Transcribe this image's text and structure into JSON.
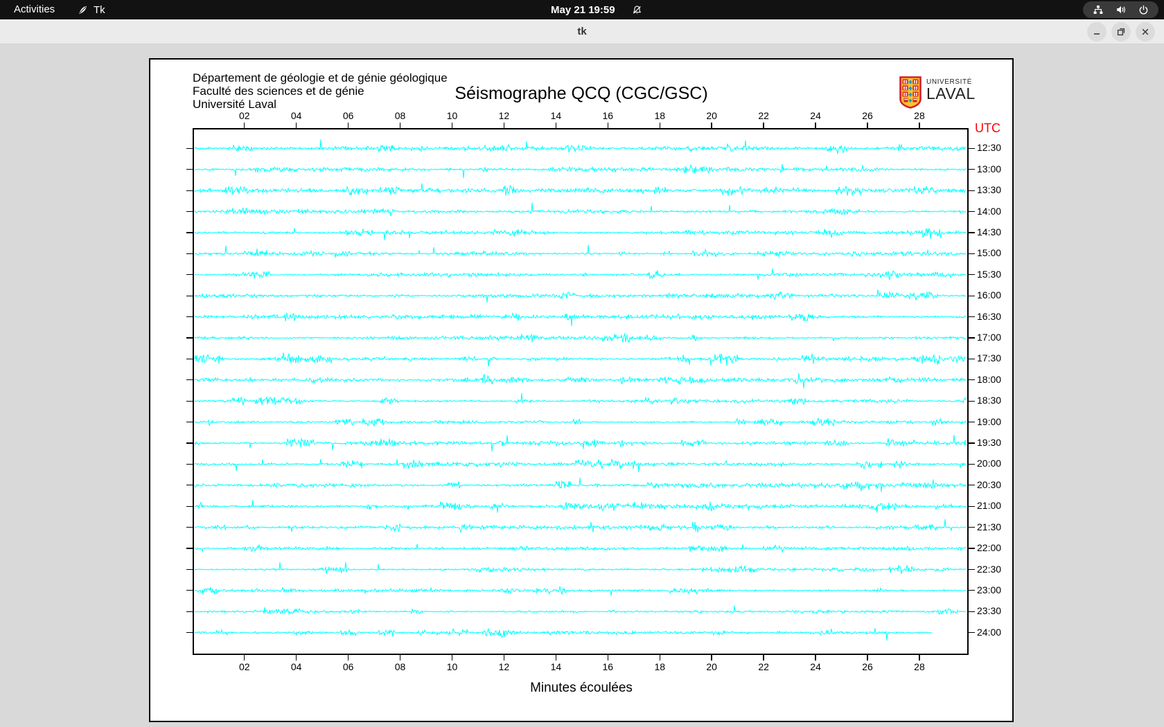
{
  "topbar": {
    "activities_label": "Activities",
    "app_name": "Tk",
    "clock": "May 21 19:59",
    "icons": {
      "app": "tk-feather-icon",
      "notifications": "bell-muted-icon",
      "network": "wired-network-icon",
      "volume": "speaker-icon",
      "power": "power-icon"
    }
  },
  "window": {
    "title": "tk",
    "controls": [
      "minimize",
      "restore",
      "close"
    ]
  },
  "canvas": {
    "header_lines": [
      "Département de géologie et de génie géologique",
      "Faculté des sciences et de génie",
      "Université Laval"
    ],
    "title": "Séismographe QCQ (CGC/GSC)",
    "logo": {
      "top": "UNIVERSITÉ",
      "bottom": "LAVAL"
    }
  },
  "chart_data": {
    "type": "line",
    "subtype": "helicorder-seismogram",
    "station": "QCQ (CGC/GSC)",
    "title": "Séismographe QCQ (CGC/GSC)",
    "xlabel": "Minutes écoulées",
    "x_range_minutes": [
      0,
      30
    ],
    "x_ticks": [
      "02",
      "04",
      "06",
      "08",
      "10",
      "12",
      "14",
      "16",
      "18",
      "20",
      "22",
      "24",
      "26",
      "28"
    ],
    "right_axis_label": "UTC",
    "right_axis_color": "#ff0000",
    "trace_color": "#00ffff",
    "axis_color": "#000000",
    "noise_seed": 20210521,
    "rows": [
      {
        "label": "12:30",
        "activity": 1.0
      },
      {
        "label": "13:00",
        "activity": 1.0
      },
      {
        "label": "13:30",
        "activity": 1.1
      },
      {
        "label": "14:00",
        "activity": 1.15
      },
      {
        "label": "14:30",
        "activity": 1.1
      },
      {
        "label": "15:00",
        "activity": 1.0
      },
      {
        "label": "15:30",
        "activity": 0.95
      },
      {
        "label": "16:00",
        "activity": 1.05
      },
      {
        "label": "16:30",
        "activity": 1.1
      },
      {
        "label": "17:00",
        "activity": 1.05
      },
      {
        "label": "17:30",
        "activity": 1.35
      },
      {
        "label": "18:00",
        "activity": 1.25
      },
      {
        "label": "18:30",
        "activity": 1.0
      },
      {
        "label": "19:00",
        "activity": 0.95
      },
      {
        "label": "19:30",
        "activity": 1.05
      },
      {
        "label": "20:00",
        "activity": 1.2
      },
      {
        "label": "20:30",
        "activity": 1.25
      },
      {
        "label": "21:00",
        "activity": 1.2
      },
      {
        "label": "21:30",
        "activity": 1.0
      },
      {
        "label": "22:00",
        "activity": 0.9
      },
      {
        "label": "22:30",
        "activity": 0.85
      },
      {
        "label": "23:00",
        "activity": 0.9
      },
      {
        "label": "23:30",
        "activity": 0.8
      },
      {
        "label": "24:00",
        "activity": 1.0,
        "fraction": 0.956
      }
    ]
  }
}
